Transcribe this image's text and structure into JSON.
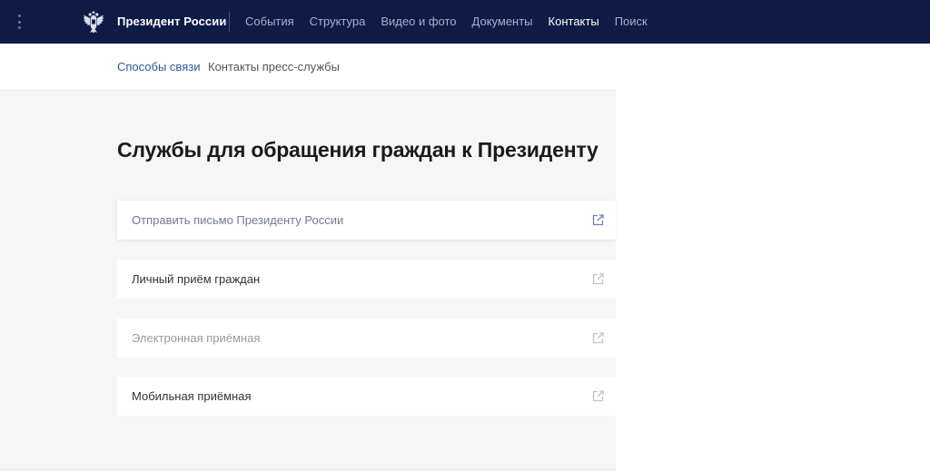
{
  "header": {
    "brand": "Президент России",
    "nav": [
      {
        "label": "События",
        "active": false
      },
      {
        "label": "Структура",
        "active": false
      },
      {
        "label": "Видео и фото",
        "active": false
      },
      {
        "label": "Документы",
        "active": false
      },
      {
        "label": "Контакты",
        "active": true
      },
      {
        "label": "Поиск",
        "active": false
      }
    ],
    "menu_icon": "vertical-dots-icon",
    "logo_icon": "double-headed-eagle-emblem-icon"
  },
  "subnav": {
    "items": [
      {
        "label": "Способы связи",
        "active": true
      },
      {
        "label": "Контакты пресс-службы",
        "active": false
      }
    ]
  },
  "main": {
    "title": "Службы для обращения граждан к Президенту",
    "services": [
      {
        "label": "Отправить письмо Президенту России",
        "icon": "external-link-icon"
      },
      {
        "label": "Личный приём граждан",
        "icon": "external-link-icon"
      },
      {
        "label": "Электронная приёмная",
        "icon": "external-link-icon"
      },
      {
        "label": "Мобильная приёмная",
        "icon": "external-link-icon"
      }
    ]
  },
  "colors": {
    "header_bg": "#0e1b44",
    "nav_text": "#a7b0cf",
    "nav_active": "#ffffff",
    "link_blue": "#2c5a9e",
    "page_bg": "#f6f6f6"
  }
}
